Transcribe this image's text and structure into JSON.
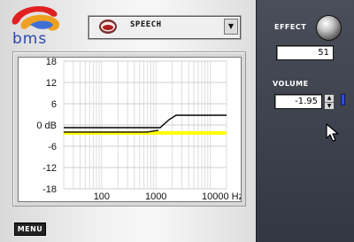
{
  "brand": {
    "logo_text": "bms"
  },
  "preset": {
    "label": "SPEECH",
    "icon": "mouth-icon",
    "arrow": "▼"
  },
  "graph": {
    "y_ticks": [
      "18",
      "12",
      "6",
      "0 dB",
      "-6",
      "-12",
      "-18"
    ],
    "x_ticks": [
      "100",
      "1000",
      "10000 Hz"
    ]
  },
  "menu_button": "MENU",
  "effect": {
    "label": "EFFECT",
    "value": "51"
  },
  "volume": {
    "label": "VOLUME",
    "value": "-1.95",
    "up": "▲",
    "down": "▼"
  },
  "colors": {
    "curve_yellow": "#ffff00",
    "curve_black": "#000000",
    "led_blue": "#2a4fd8"
  }
}
